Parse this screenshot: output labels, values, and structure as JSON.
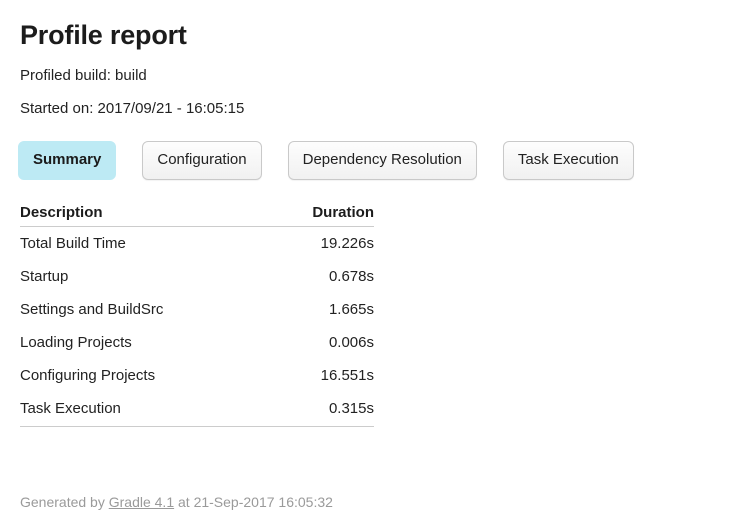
{
  "header": {
    "title": "Profile report",
    "profiled_build_label": "Profiled build: build",
    "started_on_label": "Started on: 2017/09/21 - 16:05:15"
  },
  "tabs": {
    "active": "Summary",
    "items": [
      {
        "label": "Summary",
        "active": true
      },
      {
        "label": "Configuration",
        "active": false
      },
      {
        "label": "Dependency Resolution",
        "active": false
      },
      {
        "label": "Task Execution",
        "active": false
      }
    ]
  },
  "summary_table": {
    "columns": [
      "Description",
      "Duration"
    ],
    "rows": [
      {
        "description": "Total Build Time",
        "duration": "19.226s"
      },
      {
        "description": "Startup",
        "duration": "0.678s"
      },
      {
        "description": "Settings and BuildSrc",
        "duration": "1.665s"
      },
      {
        "description": "Loading Projects",
        "duration": "0.006s"
      },
      {
        "description": "Configuring Projects",
        "duration": "16.551s"
      },
      {
        "description": "Task Execution",
        "duration": "0.315s"
      }
    ]
  },
  "footer": {
    "prefix": "Generated by ",
    "link_label": "Gradle 4.1",
    "suffix": " at 21-Sep-2017 16:05:32"
  },
  "colors": {
    "active_tab_background": "#bdeaf4",
    "inactive_tab_background": "#f1f1f1",
    "inactive_tab_border": "#c9c9c9",
    "table_border": "#cccccc",
    "text": "#222222",
    "footer_text": "#9a9a9a",
    "page_background": "#ffffff"
  }
}
